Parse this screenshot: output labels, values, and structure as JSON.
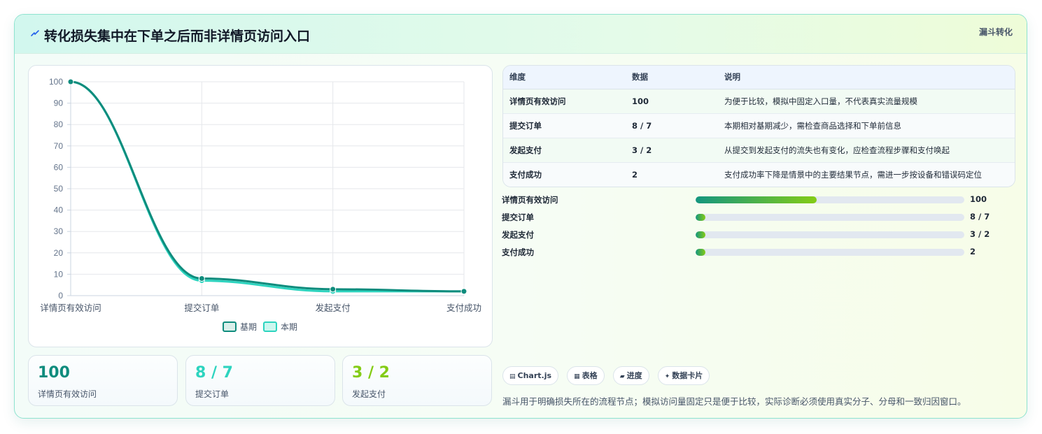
{
  "header": {
    "title": "转化损失集中在下单之后而非详情页访问入口",
    "tag": "漏斗转化",
    "icon": "lightning-icon"
  },
  "chart_data": {
    "type": "line",
    "categories": [
      "详情页有效访问",
      "提交订单",
      "发起支付",
      "支付成功"
    ],
    "series": [
      {
        "name": "基期",
        "values": [
          100,
          8,
          3,
          2
        ],
        "color": "#0f8c7d"
      },
      {
        "name": "本期",
        "values": [
          100,
          7,
          2,
          2
        ],
        "color": "#2dd4bf"
      }
    ],
    "ylim": [
      0,
      100
    ],
    "yticks": [
      0,
      10,
      20,
      30,
      40,
      50,
      60,
      70,
      80,
      90,
      100
    ],
    "grid": true,
    "legend_position": "bottom",
    "xlabel": "",
    "ylabel": ""
  },
  "kpis": [
    {
      "value": "100",
      "label": "详情页有效访问",
      "color": "#0f8c7d"
    },
    {
      "value": "8 / 7",
      "label": "提交订单",
      "color": "#2dd4bf"
    },
    {
      "value": "3 / 2",
      "label": "发起支付",
      "color": "#84cc16"
    }
  ],
  "table": {
    "headers": [
      "维度",
      "数据",
      "说明"
    ],
    "rows": [
      [
        "详情页有效访问",
        "100",
        "为便于比较，模拟中固定入口量，不代表真实流量规模"
      ],
      [
        "提交订单",
        "8 / 7",
        "本期相对基期减少，需检查商品选择和下单前信息"
      ],
      [
        "发起支付",
        "3 / 2",
        "从提交到发起支付的流失也有变化，应检查流程步骤和支付唤起"
      ],
      [
        "支付成功",
        "2",
        "支付成功率下降是情景中的主要结果节点，需进一步按设备和错误码定位"
      ]
    ]
  },
  "progress": [
    {
      "label": "详情页有效访问",
      "value": "100",
      "fill": 0.45
    },
    {
      "label": "提交订单",
      "value": "8 / 7",
      "fill": 0.036
    },
    {
      "label": "发起支付",
      "value": "3 / 2",
      "fill": 0.036
    },
    {
      "label": "支付成功",
      "value": "2",
      "fill": 0.036
    }
  ],
  "chips": [
    {
      "label": "Chart.js",
      "icon": "chart-icon",
      "glyph": "▤"
    },
    {
      "label": "表格",
      "icon": "table-icon",
      "glyph": "▦"
    },
    {
      "label": "进度",
      "icon": "progress-icon",
      "glyph": "▰"
    },
    {
      "label": "数据卡片",
      "icon": "sparkle-icon",
      "glyph": "✦"
    }
  ],
  "footnote": "漏斗用于明确损失所在的流程节点；模拟访问量固定只是便于比较，实际诊断必须使用真实分子、分母和一致归因窗口。"
}
